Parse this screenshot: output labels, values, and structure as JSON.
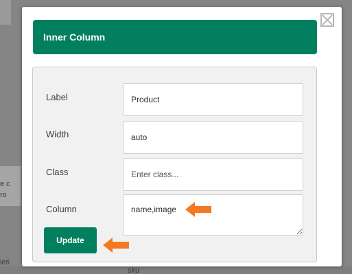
{
  "background": {
    "fragments": [
      "e c",
      "ro",
      "ies",
      "sku"
    ]
  },
  "modal": {
    "title": "Inner Column",
    "fields": [
      {
        "label": "Label",
        "value": "Product",
        "placeholder": ""
      },
      {
        "label": "Width",
        "value": "auto",
        "placeholder": ""
      },
      {
        "label": "Class",
        "value": "",
        "placeholder": "Enter class..."
      },
      {
        "label": "Column",
        "value": "name,image",
        "placeholder": ""
      }
    ],
    "update_label": "Update",
    "close_icon": "close-x-icon"
  },
  "colors": {
    "accent": "#017f5f",
    "annotation_arrow": "#f47a22",
    "overlay": "#858585"
  },
  "annotations": {
    "arrow_icon": "arrow-left-icon"
  }
}
